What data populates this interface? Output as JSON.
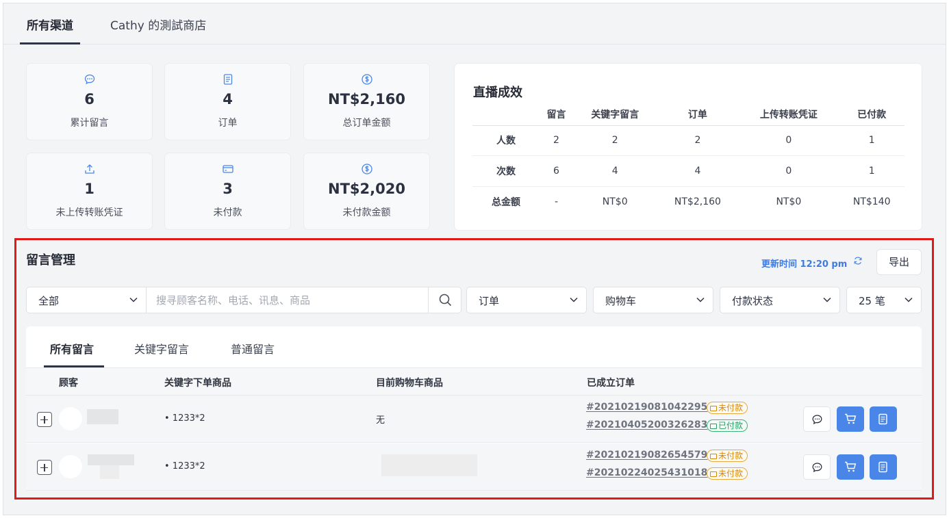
{
  "header": {
    "tabs": [
      {
        "label": "所有渠道",
        "active": true
      },
      {
        "label": "Cathy 的測試商店",
        "active": false
      }
    ]
  },
  "stats": [
    {
      "icon": "comment-icon",
      "value": "6",
      "label": "累计留言"
    },
    {
      "icon": "order-icon",
      "value": "4",
      "label": "订单"
    },
    {
      "icon": "dollar-icon",
      "value": "NT$2,160",
      "label": "总订单金额"
    },
    {
      "icon": "upload-icon",
      "value": "1",
      "label": "未上传转账凭证"
    },
    {
      "icon": "card-icon",
      "value": "3",
      "label": "未付款"
    },
    {
      "icon": "dollar-icon",
      "value": "NT$2,020",
      "label": "未付款金额"
    }
  ],
  "performance": {
    "title": "直播成效",
    "columns": [
      "留言",
      "关键字留言",
      "订单",
      "上传转账凭证",
      "已付款"
    ],
    "rows": [
      {
        "label": "人数",
        "values": [
          "2",
          "2",
          "2",
          "0",
          "1"
        ]
      },
      {
        "label": "次数",
        "values": [
          "6",
          "4",
          "4",
          "0",
          "1"
        ]
      },
      {
        "label": "总金额",
        "values": [
          "-",
          "NT$0",
          "NT$2,160",
          "NT$0",
          "NT$140"
        ]
      }
    ]
  },
  "comment_mgmt": {
    "title": "留言管理",
    "update_time": "更新时间 12:20 pm",
    "export_label": "导出",
    "filters": {
      "scope": "全部",
      "search_placeholder": "搜寻顾客名称、电话、讯息、商品",
      "order": "订单",
      "cart": "购物车",
      "payment": "付款状态",
      "page_size": "25 笔"
    },
    "tabs": [
      {
        "label": "所有留言",
        "active": true
      },
      {
        "label": "关键字留言",
        "active": false
      },
      {
        "label": "普通留言",
        "active": false
      }
    ],
    "columns": [
      "顾客",
      "关键字下单商品",
      "目前购物车商品",
      "已成立订单"
    ],
    "rows": [
      {
        "keyword_item": "• 1233*2",
        "cart_item": "无",
        "orders": [
          {
            "id": "#20210219081042295",
            "status": "未付款",
            "status_type": "unpaid"
          },
          {
            "id": "#20210405200326283",
            "status": "已付款",
            "status_type": "paid"
          }
        ]
      },
      {
        "keyword_item": "• 1233*2",
        "cart_item": "",
        "orders": [
          {
            "id": "#20210219082654579",
            "status": "未付款",
            "status_type": "unpaid"
          },
          {
            "id": "#20210224025431018",
            "status": "未付款",
            "status_type": "unpaid"
          }
        ]
      }
    ]
  },
  "colors": {
    "accent_blue": "#4a86e8",
    "unpaid": "#d38a10",
    "paid": "#26a064",
    "highlight_border": "#e01919"
  }
}
